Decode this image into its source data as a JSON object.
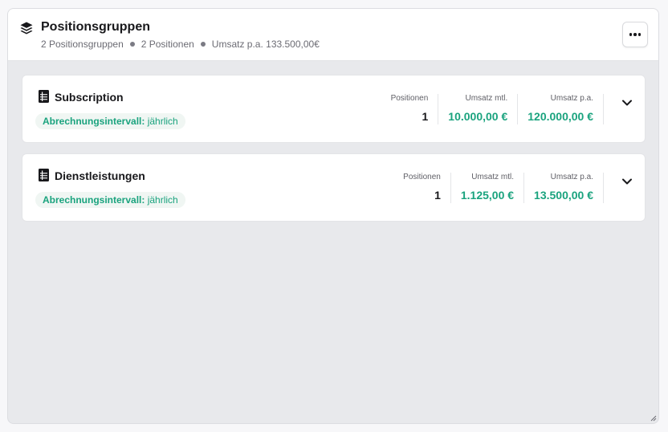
{
  "header": {
    "title": "Positionsgruppen",
    "meta": [
      "2 Positionsgruppen",
      "2 Positionen",
      "Umsatz p.a. 133.500,00€"
    ],
    "more_icon": "more-horizontal-icon",
    "title_icon": "layers-icon"
  },
  "labels": {
    "positions": "Positionen",
    "revenue_monthly": "Umsatz mtl.",
    "revenue_yearly": "Umsatz p.a."
  },
  "groups": [
    {
      "title": "Subscription",
      "interval_label": "Abrechnungsintervall:",
      "interval_value": "jährlich",
      "positions": "1",
      "revenue_monthly": "10.000,00 €",
      "revenue_yearly": "120.000,00 €"
    },
    {
      "title": "Dienstleistungen",
      "interval_label": "Abrechnungsintervall:",
      "interval_value": "jährlich",
      "positions": "1",
      "revenue_monthly": "1.125,00 €",
      "revenue_yearly": "13.500,00 €"
    }
  ],
  "colors": {
    "accent": "#1aa37e",
    "text": "#18181b",
    "panel_background": "#e8e9ec"
  }
}
